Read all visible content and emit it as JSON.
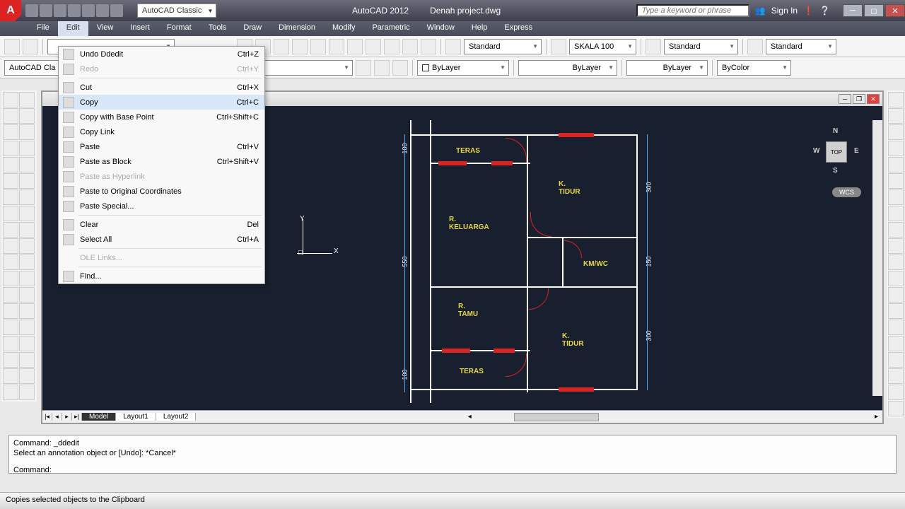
{
  "title": {
    "app": "AutoCAD 2012",
    "file": "Denah project.dwg"
  },
  "workspace": "AutoCAD Classic",
  "search": {
    "placeholder": "Type a keyword or phrase"
  },
  "signin": "Sign In",
  "menubar": [
    "File",
    "Edit",
    "View",
    "Insert",
    "Format",
    "Tools",
    "Draw",
    "Dimension",
    "Modify",
    "Parametric",
    "Window",
    "Help",
    "Express"
  ],
  "active_menu_index": 1,
  "toolbar2": {
    "label": "AutoCAD Cla",
    "style1": "Standard",
    "style2": "SKALA 100",
    "style3": "Standard",
    "style4": "Standard"
  },
  "toolbar3": {
    "layer": "ByLayer",
    "ltype": "ByLayer",
    "lweight": "ByLayer",
    "color": "ByColor"
  },
  "context_menu": [
    {
      "label": "Undo Ddedit",
      "shortcut": "Ctrl+Z",
      "icon": true
    },
    {
      "label": "Redo",
      "shortcut": "Ctrl+Y",
      "disabled": true,
      "icon": true
    },
    {
      "sep": true
    },
    {
      "label": "Cut",
      "shortcut": "Ctrl+X",
      "icon": true
    },
    {
      "label": "Copy",
      "shortcut": "Ctrl+C",
      "icon": true,
      "hover": true
    },
    {
      "label": "Copy with Base Point",
      "shortcut": "Ctrl+Shift+C",
      "icon": true
    },
    {
      "label": "Copy Link",
      "icon": true
    },
    {
      "label": "Paste",
      "shortcut": "Ctrl+V",
      "icon": true
    },
    {
      "label": "Paste as Block",
      "shortcut": "Ctrl+Shift+V",
      "icon": true
    },
    {
      "label": "Paste as Hyperlink",
      "disabled": true,
      "icon": true
    },
    {
      "label": "Paste to Original Coordinates",
      "icon": true
    },
    {
      "label": "Paste Special...",
      "icon": true
    },
    {
      "sep": true
    },
    {
      "label": "Clear",
      "shortcut": "Del",
      "icon": true
    },
    {
      "label": "Select All",
      "shortcut": "Ctrl+A",
      "icon": true
    },
    {
      "sep": true
    },
    {
      "label": "OLE Links...",
      "disabled": true
    },
    {
      "sep": true
    },
    {
      "label": "Find...",
      "icon": true
    }
  ],
  "rooms": {
    "teras1": "TERAS",
    "keluarga": "R. KELUARGA",
    "ktidur1": "K. TIDUR",
    "kmwc": "KM/WC",
    "tamu": "R. TAMU",
    "ktidur2": "K. TIDUR",
    "teras2": "TERAS"
  },
  "dims": {
    "d100a": "100",
    "d550": "550",
    "d100b": "100",
    "d300a": "300",
    "d150": "150",
    "d300b": "300"
  },
  "viewcube": {
    "top": "TOP",
    "n": "N",
    "s": "S",
    "e": "E",
    "w": "W",
    "wcs": "WCS"
  },
  "tabs": {
    "model": "Model",
    "l1": "Layout1",
    "l2": "Layout2"
  },
  "cmd": {
    "l1": "Command: _ddedit",
    "l2": "Select an annotation object or [Undo]: *Cancel*",
    "l3": "Command:"
  },
  "status": "Copies selected objects to the Clipboard"
}
